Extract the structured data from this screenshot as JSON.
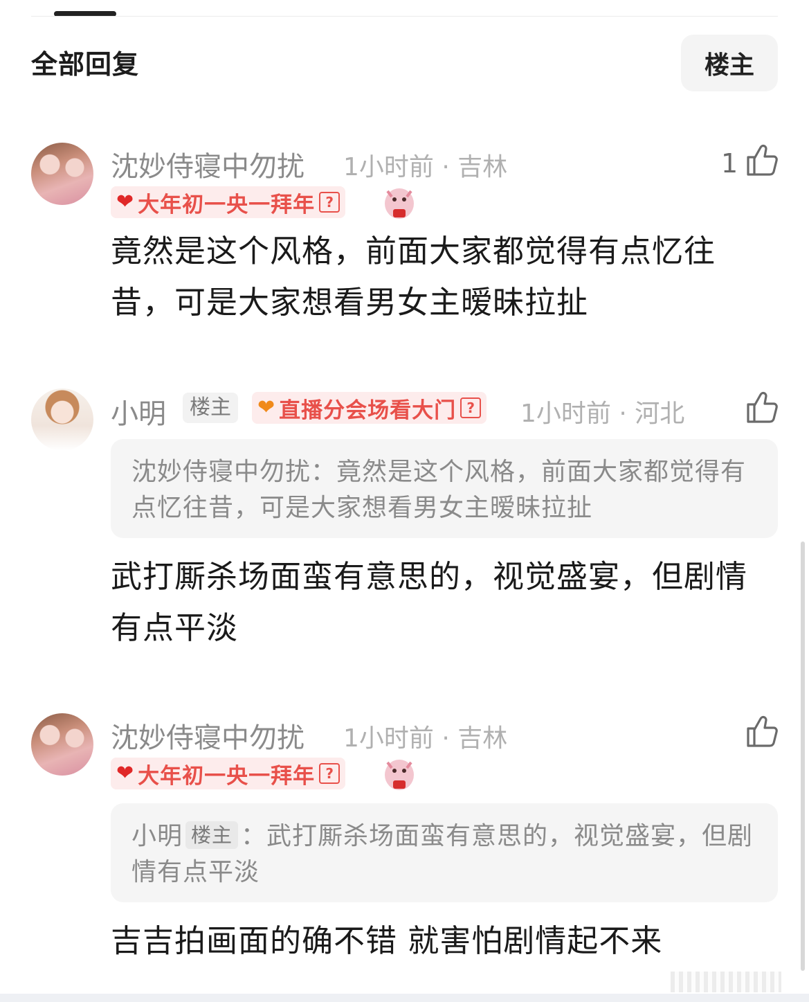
{
  "header": {
    "title": "全部回复",
    "filter_label": "楼主"
  },
  "comments": [
    {
      "username": "沈妙侍寝中勿扰",
      "meta": "1小时前 · 吉林",
      "badge": "大年初一央一拜年",
      "badge_icon": "heart-red",
      "likes": "1",
      "content": "竟然是这个风格，前面大家都觉得有点忆往昔，可是大家想看男女主暧昧拉扯"
    },
    {
      "username": "小明",
      "owner_tag": "楼主",
      "badge": "直播分会场看大门",
      "badge_icon": "heart-orange",
      "meta": "1小时前 · 河北",
      "quote": {
        "author": "沈妙侍寝中勿扰",
        "separator": "：",
        "text": "竟然是这个风格，前面大家都觉得有点忆往昔，可是大家想看男女主暧昧拉扯"
      },
      "content": "武打厮杀场面蛮有意思的，视觉盛宴，但剧情有点平淡"
    },
    {
      "username": "沈妙侍寝中勿扰",
      "meta": "1小时前 · 吉林",
      "badge": "大年初一央一拜年",
      "badge_icon": "heart-red",
      "quote": {
        "author": "小明",
        "owner_tag": "楼主",
        "separator": "：",
        "text": "武打厮杀场面蛮有意思的，视觉盛宴，但剧情有点平淡"
      },
      "content": "吉吉拍画面的确不错 就害怕剧情起不来"
    }
  ],
  "colors": {
    "badge_text": "#e8504a",
    "badge_bg": "#fdecec",
    "name": "#8a8a8a",
    "meta": "#b0b0b0"
  }
}
